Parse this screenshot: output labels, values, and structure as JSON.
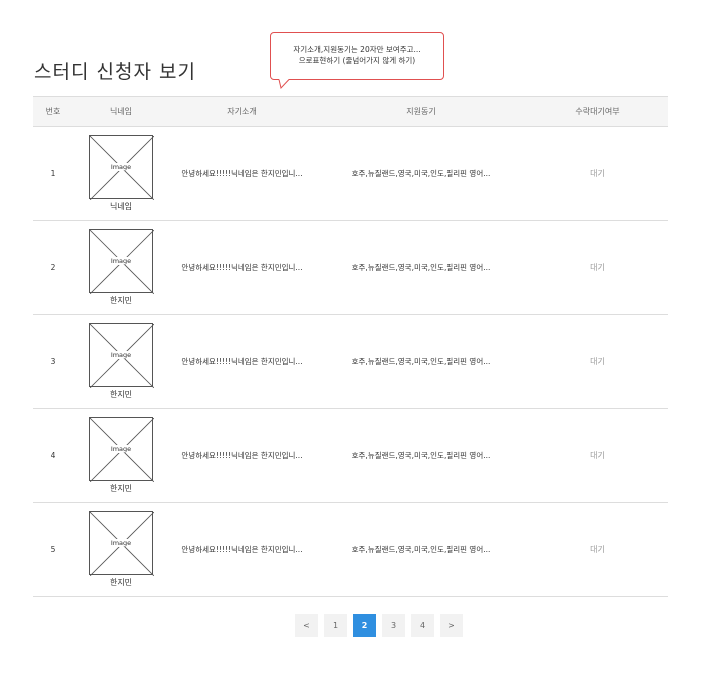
{
  "page": {
    "title": "스터디 신청자 보기"
  },
  "callout": {
    "line1": "자기소개,지원동기는 20자만 보여주고...",
    "line2": "으로표현하기 (줄넘어가지 않게 하기)"
  },
  "table": {
    "headers": [
      "번호",
      "닉네임",
      "자기소개",
      "지원동기",
      "수락대기여부"
    ],
    "placeholder_label": "Image",
    "rows": [
      {
        "no": "1",
        "nickname": "닉네임",
        "intro": "안녕하세요!!!!!닉네임은 한지민입니...",
        "motive": "호주,뉴질랜드,영국,미국,인도,필리핀 영어...",
        "status": "대기"
      },
      {
        "no": "2",
        "nickname": "한지민",
        "intro": "안녕하세요!!!!!닉네임은 한지민입니...",
        "motive": "호주,뉴질랜드,영국,미국,인도,필리핀 영어...",
        "status": "대기"
      },
      {
        "no": "3",
        "nickname": "한지민",
        "intro": "안녕하세요!!!!!닉네임은 한지민입니...",
        "motive": "호주,뉴질랜드,영국,미국,인도,필리핀 영어...",
        "status": "대기"
      },
      {
        "no": "4",
        "nickname": "한지민",
        "intro": "안녕하세요!!!!!닉네임은 한지민입니...",
        "motive": "호주,뉴질랜드,영국,미국,인도,필리핀 영어...",
        "status": "대기"
      },
      {
        "no": "5",
        "nickname": "한지민",
        "intro": "안녕하세요!!!!!닉네임은 한지민입니...",
        "motive": "호주,뉴질랜드,영국,미국,인도,필리핀 영어...",
        "status": "대기"
      }
    ]
  },
  "pagination": {
    "prev": "<",
    "pages": [
      "1",
      "2",
      "3",
      "4"
    ],
    "current": "2",
    "next": ">"
  },
  "colors": {
    "accent": "#2f8fe0",
    "callout_border": "#e05050"
  }
}
